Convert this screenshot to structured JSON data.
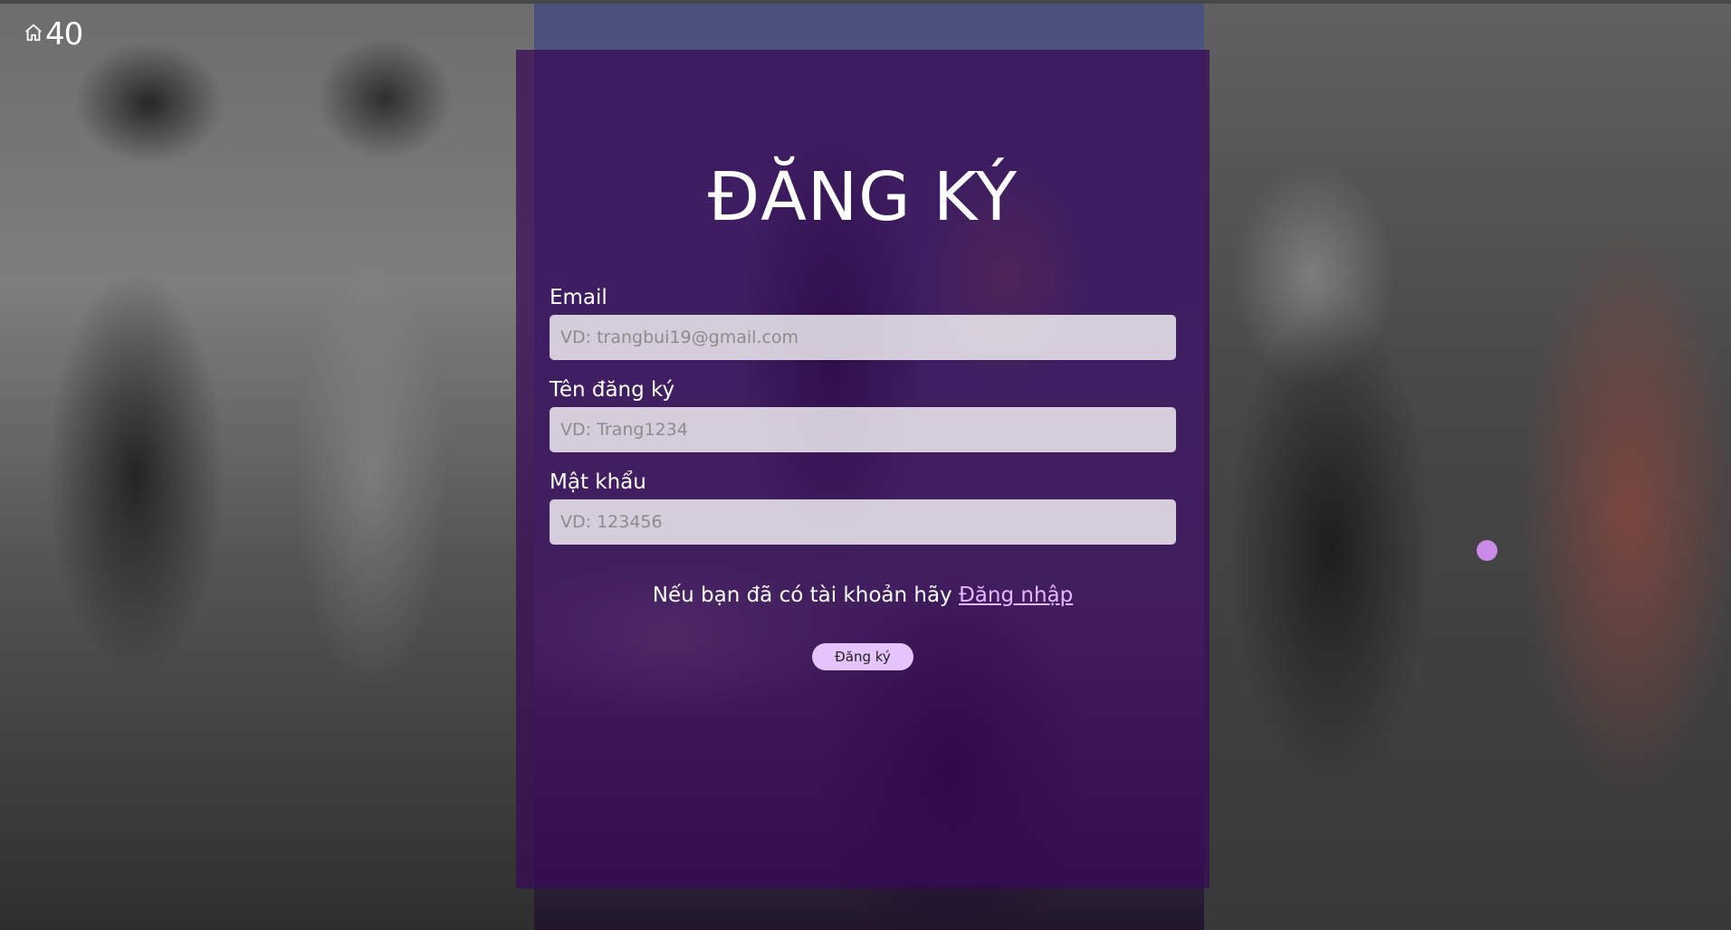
{
  "logo": {
    "icon": "home-icon",
    "text": "40"
  },
  "form": {
    "title": "ĐĂNG KÝ",
    "email": {
      "label": "Email",
      "placeholder": "VD: trangbui19@gmail.com",
      "value": ""
    },
    "username": {
      "label": "Tên đăng ký",
      "placeholder": "VD: Trang1234",
      "value": ""
    },
    "password": {
      "label": "Mật khẩu",
      "placeholder": "VD: 123456",
      "value": ""
    },
    "login_prompt": "Nếu bạn đã có tài khoản hãy ",
    "login_link": "Đăng nhập",
    "submit_label": "Đăng ký"
  },
  "colors": {
    "card_overlay": "#370a55",
    "button": "#e5c3fb",
    "link": "#e7b8ff",
    "cursor": "#c98ae8"
  }
}
